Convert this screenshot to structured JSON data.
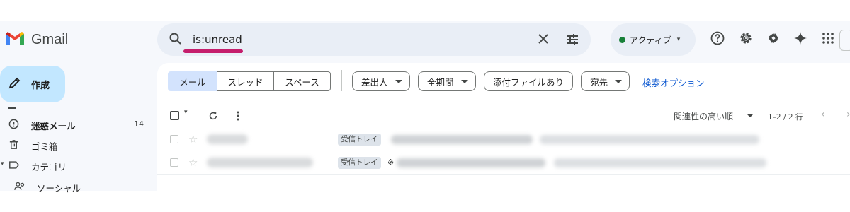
{
  "app": {
    "name": "Gmail"
  },
  "search": {
    "query": "is:unread"
  },
  "status": {
    "label": "アクティブ"
  },
  "compose": {
    "label": "作成"
  },
  "sidebar": {
    "items": [
      {
        "label": "迷惑メール",
        "count": "14",
        "icon": "spam-icon",
        "bold": true
      },
      {
        "label": "ゴミ箱",
        "count": "",
        "icon": "trash-icon",
        "bold": false
      },
      {
        "label": "カテゴリ",
        "count": "",
        "icon": "label-icon",
        "bold": false
      },
      {
        "label": "ソーシャル",
        "count": "",
        "icon": "social-icon",
        "bold": false
      }
    ]
  },
  "filters": {
    "tabs": [
      "メール",
      "スレッド",
      "スペース"
    ],
    "active_tab": "メール",
    "chips": [
      "差出人",
      "全期間",
      "添付ファイルあり",
      "宛先"
    ],
    "advanced": "検索オプション"
  },
  "toolbar": {
    "sort": "関連性の高い順",
    "pager": "1–2 / 2 行"
  },
  "emails": [
    {
      "label": "受信トレイ",
      "preview_mark": ""
    },
    {
      "label": "受信トレイ",
      "preview_mark": "※"
    }
  ],
  "colors": {
    "accent": "#0b57d0",
    "compose_bg": "#c2e7ff",
    "active_tab_bg": "#d3e3fd",
    "search_bg": "#e9eef6",
    "status_dot": "#188038",
    "annotation_underline": "#c51e6c"
  }
}
